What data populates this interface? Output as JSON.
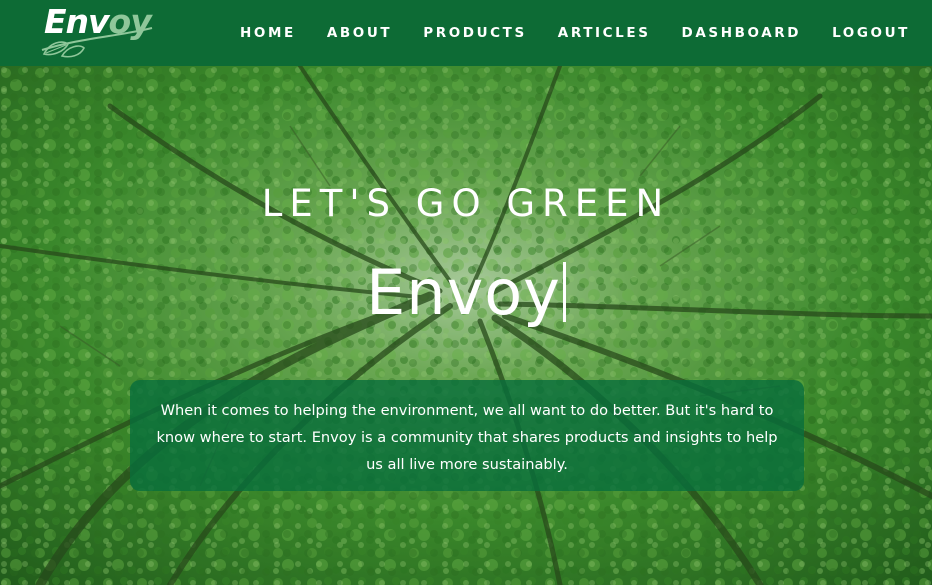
{
  "brand": {
    "logo_primary": "Env",
    "logo_accent": "oy",
    "color": "#0d6b35",
    "accent": "#8fc79a"
  },
  "nav": {
    "items": [
      {
        "label": "HOME"
      },
      {
        "label": "ABOUT"
      },
      {
        "label": "PRODUCTS"
      },
      {
        "label": "ARTICLES"
      },
      {
        "label": "DASHBOARD"
      },
      {
        "label": "LOGOUT"
      }
    ]
  },
  "hero": {
    "tagline": "LET'S GO GREEN",
    "title": "Envoy",
    "description": "When it comes to helping the environment, we all want to do better. But it's hard to know where to start. Envoy is a community that shares products and insights to help us all live more sustainably.",
    "background": "tree-canopy-image"
  }
}
